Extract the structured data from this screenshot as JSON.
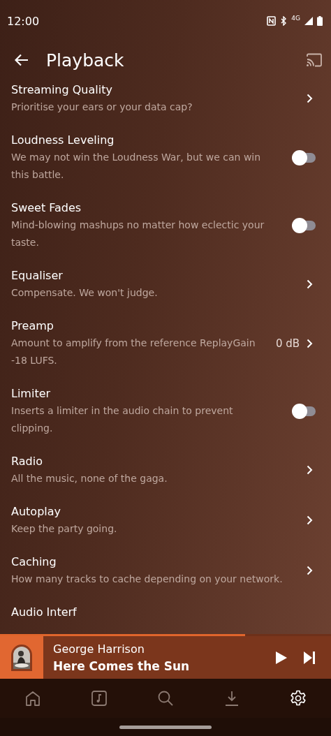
{
  "status_bar": {
    "time": "12:00",
    "network": "4G"
  },
  "header": {
    "title": "Playback"
  },
  "settings": [
    {
      "kind": "link",
      "title": "Streaming Quality",
      "subtitle": "Prioritise your ears or your data cap?"
    },
    {
      "kind": "toggle",
      "title": "Loudness Leveling",
      "subtitle": "We may not win the Loudness War, but we can win this battle.",
      "on": false
    },
    {
      "kind": "toggle",
      "title": "Sweet Fades",
      "subtitle": "Mind-blowing mashups no matter how eclectic your taste.",
      "on": false
    },
    {
      "kind": "link",
      "title": "Equaliser",
      "subtitle": "Compensate. We won't judge."
    },
    {
      "kind": "link",
      "title": "Preamp",
      "subtitle": "Amount to amplify from the reference ReplayGain -18 LUFS.",
      "value": "0 dB"
    },
    {
      "kind": "toggle",
      "title": "Limiter",
      "subtitle": "Inserts a limiter in the audio chain to prevent clipping.",
      "on": false
    },
    {
      "kind": "link",
      "title": "Radio",
      "subtitle": "All the music, none of the gaga."
    },
    {
      "kind": "link",
      "title": "Autoplay",
      "subtitle": "Keep the party going."
    },
    {
      "kind": "link",
      "title": "Caching",
      "subtitle": "How many tracks to cache depending on your network."
    },
    {
      "kind": "cut",
      "title": "Audio Interf"
    }
  ],
  "player": {
    "artist": "George Harrison",
    "track": "Here Comes the Sun",
    "level": 0.74
  },
  "nav": [
    {
      "selected": false
    },
    {
      "selected": false
    },
    {
      "selected": false
    },
    {
      "selected": false
    },
    {
      "selected": true
    }
  ]
}
